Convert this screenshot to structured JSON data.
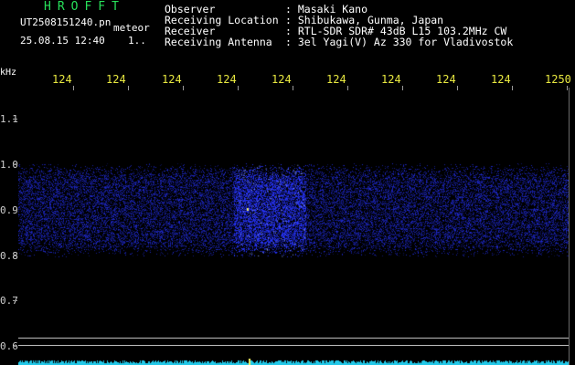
{
  "header": {
    "brand": "HROFFT",
    "filename": "UT2508151240.pn",
    "meteor_label": "meteor",
    "datetime": "25.08.15 12:40",
    "count": "1.."
  },
  "info": {
    "labels": [
      "Observer",
      "Receiving Location",
      "Receiver",
      "Receiving Antenna"
    ],
    "values": [
      ": Masaki Kano",
      ": Shibukawa, Gunma, Japan",
      ": RTL-SDR SDR# 43dB L15 103.2MHz CW",
      ": 3el Yagi(V) Az 330 for Vladivostok"
    ]
  },
  "axes": {
    "y_unit": "kHz",
    "x_labels": [
      "124",
      "124",
      "124",
      "124",
      "124",
      "124",
      "124",
      "124",
      "124",
      "1250"
    ],
    "y_labels": [
      "1.1",
      "1.0",
      "0.9",
      "0.8",
      "0.7",
      "0.6"
    ]
  },
  "colors": {
    "brand": "#27e05a",
    "freq_labels": "#e8e840",
    "signal": "#2b3bd6",
    "baseline": "#22c8e8",
    "background": "#000000"
  }
}
